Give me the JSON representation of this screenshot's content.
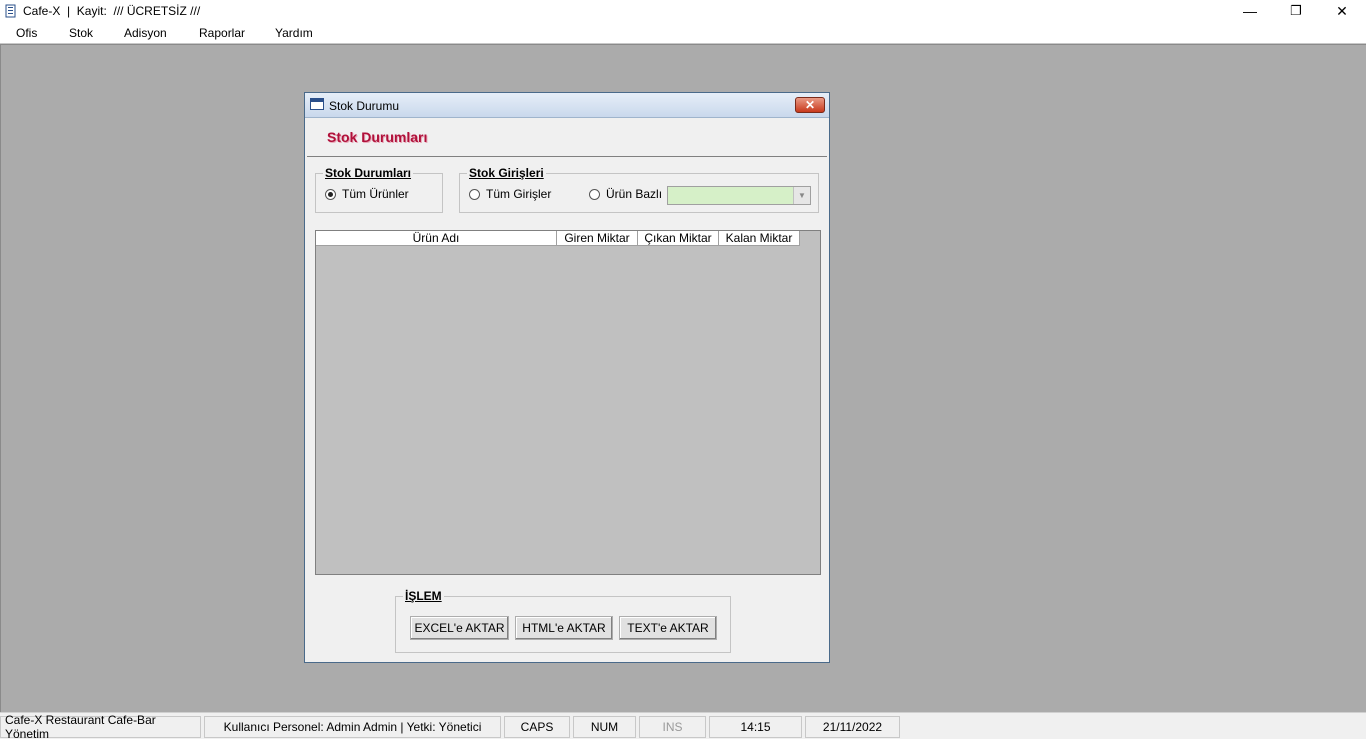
{
  "app": {
    "title": "Cafe-X  |  Kayit:  /// ÜCRETSİZ ///",
    "min_glyph": "—",
    "restore_glyph": "❐",
    "close_glyph": "✕"
  },
  "menu": [
    "Ofis",
    "Stok",
    "Adisyon",
    "Raporlar",
    "Yardım"
  ],
  "dialog": {
    "title": "Stok Durumu",
    "close_glyph": "✕",
    "header": "Stok Durumları",
    "group_stok_durumlari": {
      "label": "Stok Durumları",
      "option_tum_urunler": "Tüm Ürünler",
      "option_tum_urunler_checked": true
    },
    "group_stok_girisleri": {
      "label": "Stok Girişleri",
      "option_tum_girisler": "Tüm Girişler",
      "option_urun_bazli": "Ürün Bazlı",
      "combo_value": "",
      "combo_arrow": "▼"
    },
    "grid": {
      "columns": [
        "Ürün Adı",
        "Giren Miktar",
        "Çıkan Miktar",
        "Kalan Miktar"
      ],
      "rows": []
    },
    "islem": {
      "label": "İŞLEM",
      "excel_button": "EXCEL'e AKTAR",
      "html_button": "HTML'e AKTAR",
      "text_button": "TEXT'e AKTAR"
    }
  },
  "status": {
    "app_name": "Cafe-X Restaurant Cafe-Bar Yönetim",
    "user": "Kullanıcı Personel: Admin Admin  |  Yetki: Yönetici",
    "caps": "CAPS",
    "num": "NUM",
    "ins": "INS",
    "time": "14:15",
    "date": "21/11/2022"
  },
  "colors": {
    "desktop": "#ababab",
    "header_text": "#b0103a",
    "combo_bg": "#d6f0c8",
    "grid_bg": "#c0c0c0"
  }
}
